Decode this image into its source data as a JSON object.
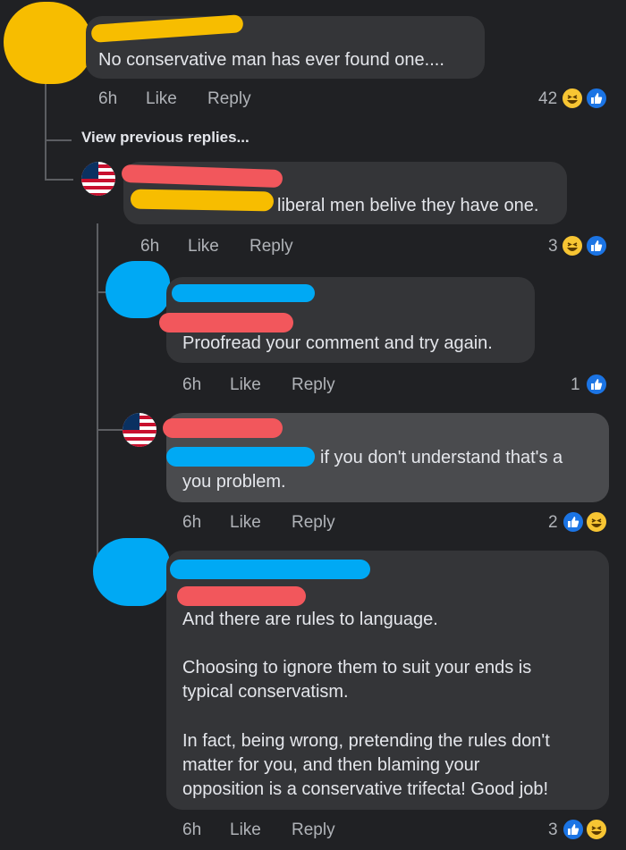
{
  "colors": {
    "background": "#202124",
    "bubble": "#343538",
    "bubble_highlight": "#4a4b4e",
    "like_blue": "#1b74e4",
    "haha_yellow": "#f7c533",
    "redact_yellow": "#f7bd00",
    "redact_red": "#f2575c",
    "redact_blue": "#00a9f4"
  },
  "thread": {
    "view_previous": "View previous replies..."
  },
  "comments": [
    {
      "text": "No conservative man has ever found one....",
      "time": "6h",
      "like": "Like",
      "reply": "Reply",
      "reaction_count": "42",
      "reactions": [
        "haha-icon",
        "like-icon"
      ]
    },
    {
      "text": "liberal men belive they have one.",
      "time": "6h",
      "like": "Like",
      "reply": "Reply",
      "reaction_count": "3",
      "reactions": [
        "haha-icon",
        "like-icon"
      ]
    },
    {
      "text": "Proofread your comment and try again.",
      "time": "6h",
      "like": "Like",
      "reply": "Reply",
      "reaction_count": "1",
      "reactions": [
        "like-icon"
      ]
    },
    {
      "text_line1": "if you don't understand that's a",
      "text_line2": "you problem.",
      "time": "6h",
      "like": "Like",
      "reply": "Reply",
      "reaction_count": "2",
      "reactions": [
        "like-icon",
        "haha-icon"
      ]
    },
    {
      "p1": "And there are rules to language.",
      "p2": "Choosing to ignore them to suit your ends is\ntypical conservatism.",
      "p3": "In fact, being wrong, pretending the rules don't\nmatter for you, and then blaming your\nopposition is a conservative trifecta! Good job!",
      "time": "6h",
      "like": "Like",
      "reply": "Reply",
      "reaction_count": "3",
      "reactions": [
        "like-icon",
        "haha-icon"
      ]
    }
  ]
}
